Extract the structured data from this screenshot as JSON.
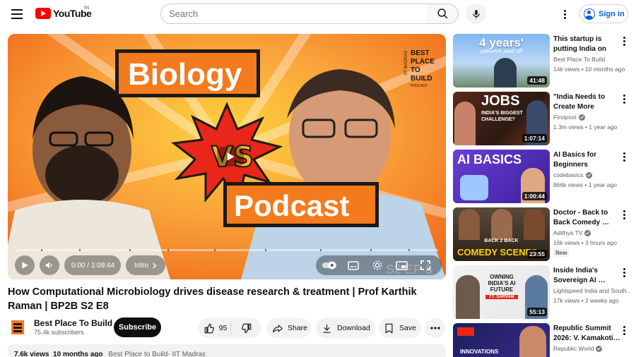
{
  "header": {
    "logo_text": "YouTube",
    "region": "IN",
    "search_placeholder": "Search",
    "sign_in": "Sign in"
  },
  "player": {
    "thumbnail_text": {
      "word1": "Biology",
      "vs": "VS",
      "word2": "Podcast",
      "corner": "S2 EP 8",
      "brand_top": "IIT MADRAS",
      "brand_name": [
        "BEST",
        "PLACE",
        "TO",
        "BUILD"
      ],
      "brand_sub": "PODCAST"
    },
    "time_current": "0:00",
    "time_sep": " / ",
    "time_total": "1:09:44",
    "chapter": "Intro",
    "progress_fraction": 0.0,
    "chapter_markers": [
      0.06,
      0.15,
      0.27,
      0.36,
      0.47,
      0.59,
      0.72,
      0.84,
      0.93
    ]
  },
  "video": {
    "title": "How Computational Microbiology drives disease research & treatment | Prof Karthik Raman | BP2B S2 E8",
    "channel": "Best Place To Build",
    "subscribers": "75.4k subscribers",
    "subscribe_label": "Subscribe",
    "likes": "95",
    "share_label": "Share",
    "download_label": "Download",
    "save_label": "Save",
    "views": "7.6k views",
    "age": "10 months ago",
    "tag": "Best Place to Build- IIT Madras"
  },
  "recommendations": [
    {
      "title": "This startup is putting India on th…",
      "channel": "Best Place To Build",
      "verified": false,
      "views": "14k views",
      "age": "10 months ago",
      "duration": "41:48",
      "new": "",
      "thumb_text": "4 years'",
      "thumb_sub": "patience paid off"
    },
    {
      "title": "\"India Needs to Create More Jobs\"…",
      "channel": "Firstpost",
      "verified": true,
      "views": "1.3m views",
      "age": "1 year ago",
      "duration": "1:07:14",
      "new": "",
      "thumb_text": "JOBS",
      "thumb_sub": "INDIA'S BIGGEST CHALLENGE?"
    },
    {
      "title": "AI Basics for Beginners",
      "channel": "codebasics",
      "verified": true,
      "views": "866k views",
      "age": "1 year ago",
      "duration": "1:00:44",
      "new": "",
      "thumb_text": "AI BASICS",
      "thumb_sub": ""
    },
    {
      "title": "Doctor - Back to Back Comedy …",
      "channel": "Adithya TV",
      "verified": true,
      "views": "16k views",
      "age": "3 hours ago",
      "duration": "23:55",
      "new": "New",
      "thumb_text": "COMEDY SCENES",
      "thumb_sub": "BACK 2 BACK"
    },
    {
      "title": "Inside India's Sovereign AI …",
      "channel": "Lightspeed India and South…",
      "verified": false,
      "views": "17k views",
      "age": "2 weeks ago",
      "duration": "55:13",
      "new": "",
      "thumb_text": "OWNING INDIA'S AI FUTURE",
      "thumb_sub": "FT. SARVAM"
    },
    {
      "title": "Republic Summit 2026: V. Kamakoti…",
      "channel": "Republic World",
      "verified": true,
      "views": "",
      "age": "",
      "duration": "",
      "new": "",
      "thumb_text": "INNOVATIONS",
      "thumb_sub": ""
    }
  ],
  "colors": {
    "accent_red": "#ff0000",
    "link_blue": "#065fd4",
    "thumb_orange": "#f47a1e"
  }
}
